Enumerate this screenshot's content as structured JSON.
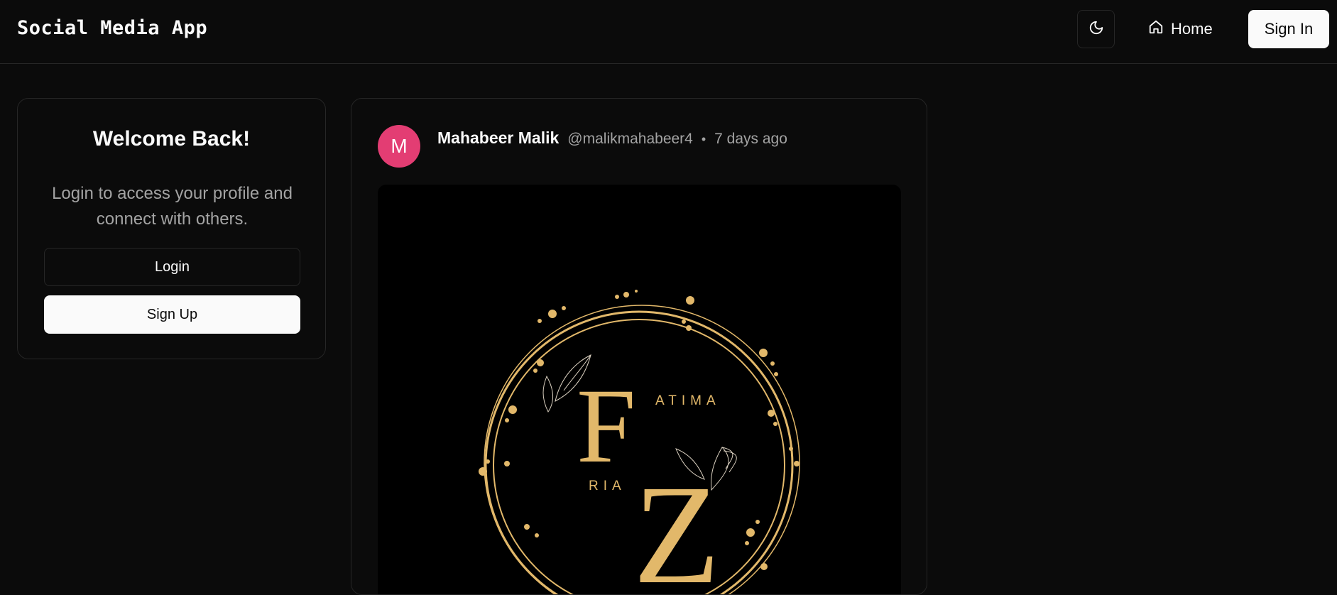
{
  "header": {
    "app_title": "Social Media App",
    "theme_toggle_icon": "moon-icon",
    "home_icon": "home-icon",
    "home_label": "Home",
    "sign_in_label": "Sign In"
  },
  "welcome": {
    "title": "Welcome Back!",
    "description": "Login to access your profile and connect with others.",
    "login_label": "Login",
    "signup_label": "Sign Up"
  },
  "post": {
    "avatar_initial": "M",
    "avatar_color": "#e33d73",
    "author_name": "Mahabeer Malik",
    "author_handle": "@malikmahabeer4",
    "separator": "•",
    "time_ago": "7 days ago",
    "image": {
      "logo_text_top": "ATIMA",
      "logo_text_bottom": "RIA",
      "logo_letter_1": "F",
      "logo_letter_2": "Z",
      "logo_color": "#e2b86a"
    }
  },
  "colors": {
    "background": "#0b0b0b",
    "border": "#262626",
    "muted_text": "#a3a3a3",
    "primary_button": "#fafafa"
  }
}
